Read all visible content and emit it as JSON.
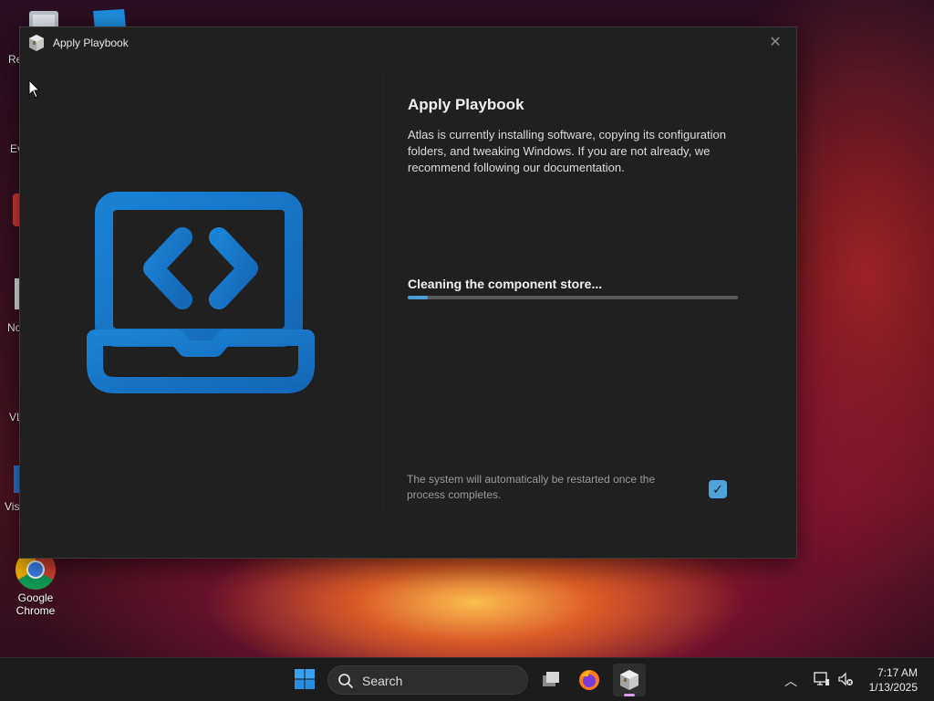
{
  "desktop": {
    "icons": [
      {
        "label": "Re"
      },
      {
        "label": "Ev"
      },
      {
        "label": "No"
      },
      {
        "label": "VL"
      },
      {
        "label": "Vis"
      },
      {
        "label": "Google Chrome",
        "line1": "Google",
        "line2": "Chrome"
      }
    ]
  },
  "window": {
    "title": "Apply Playbook",
    "close_symbol": "✕",
    "heading": "Apply Playbook",
    "description": "Atlas is currently installing software, copying its configuration folders, and tweaking Windows. If you are not already, we recommend following our documentation.",
    "status": "Cleaning the component store...",
    "progress": 0.06,
    "restart_note": "The system will automatically be restarted once the process completes.",
    "restart_checked": true,
    "accent_color": "#1a78c8"
  },
  "taskbar": {
    "search_label": "Search",
    "apps": [
      {
        "name": "task-view-icon"
      },
      {
        "name": "firefox-icon"
      },
      {
        "name": "atlas-playbook-icon",
        "active": true
      }
    ],
    "time": "7:17 AM",
    "date": "1/13/2025"
  }
}
